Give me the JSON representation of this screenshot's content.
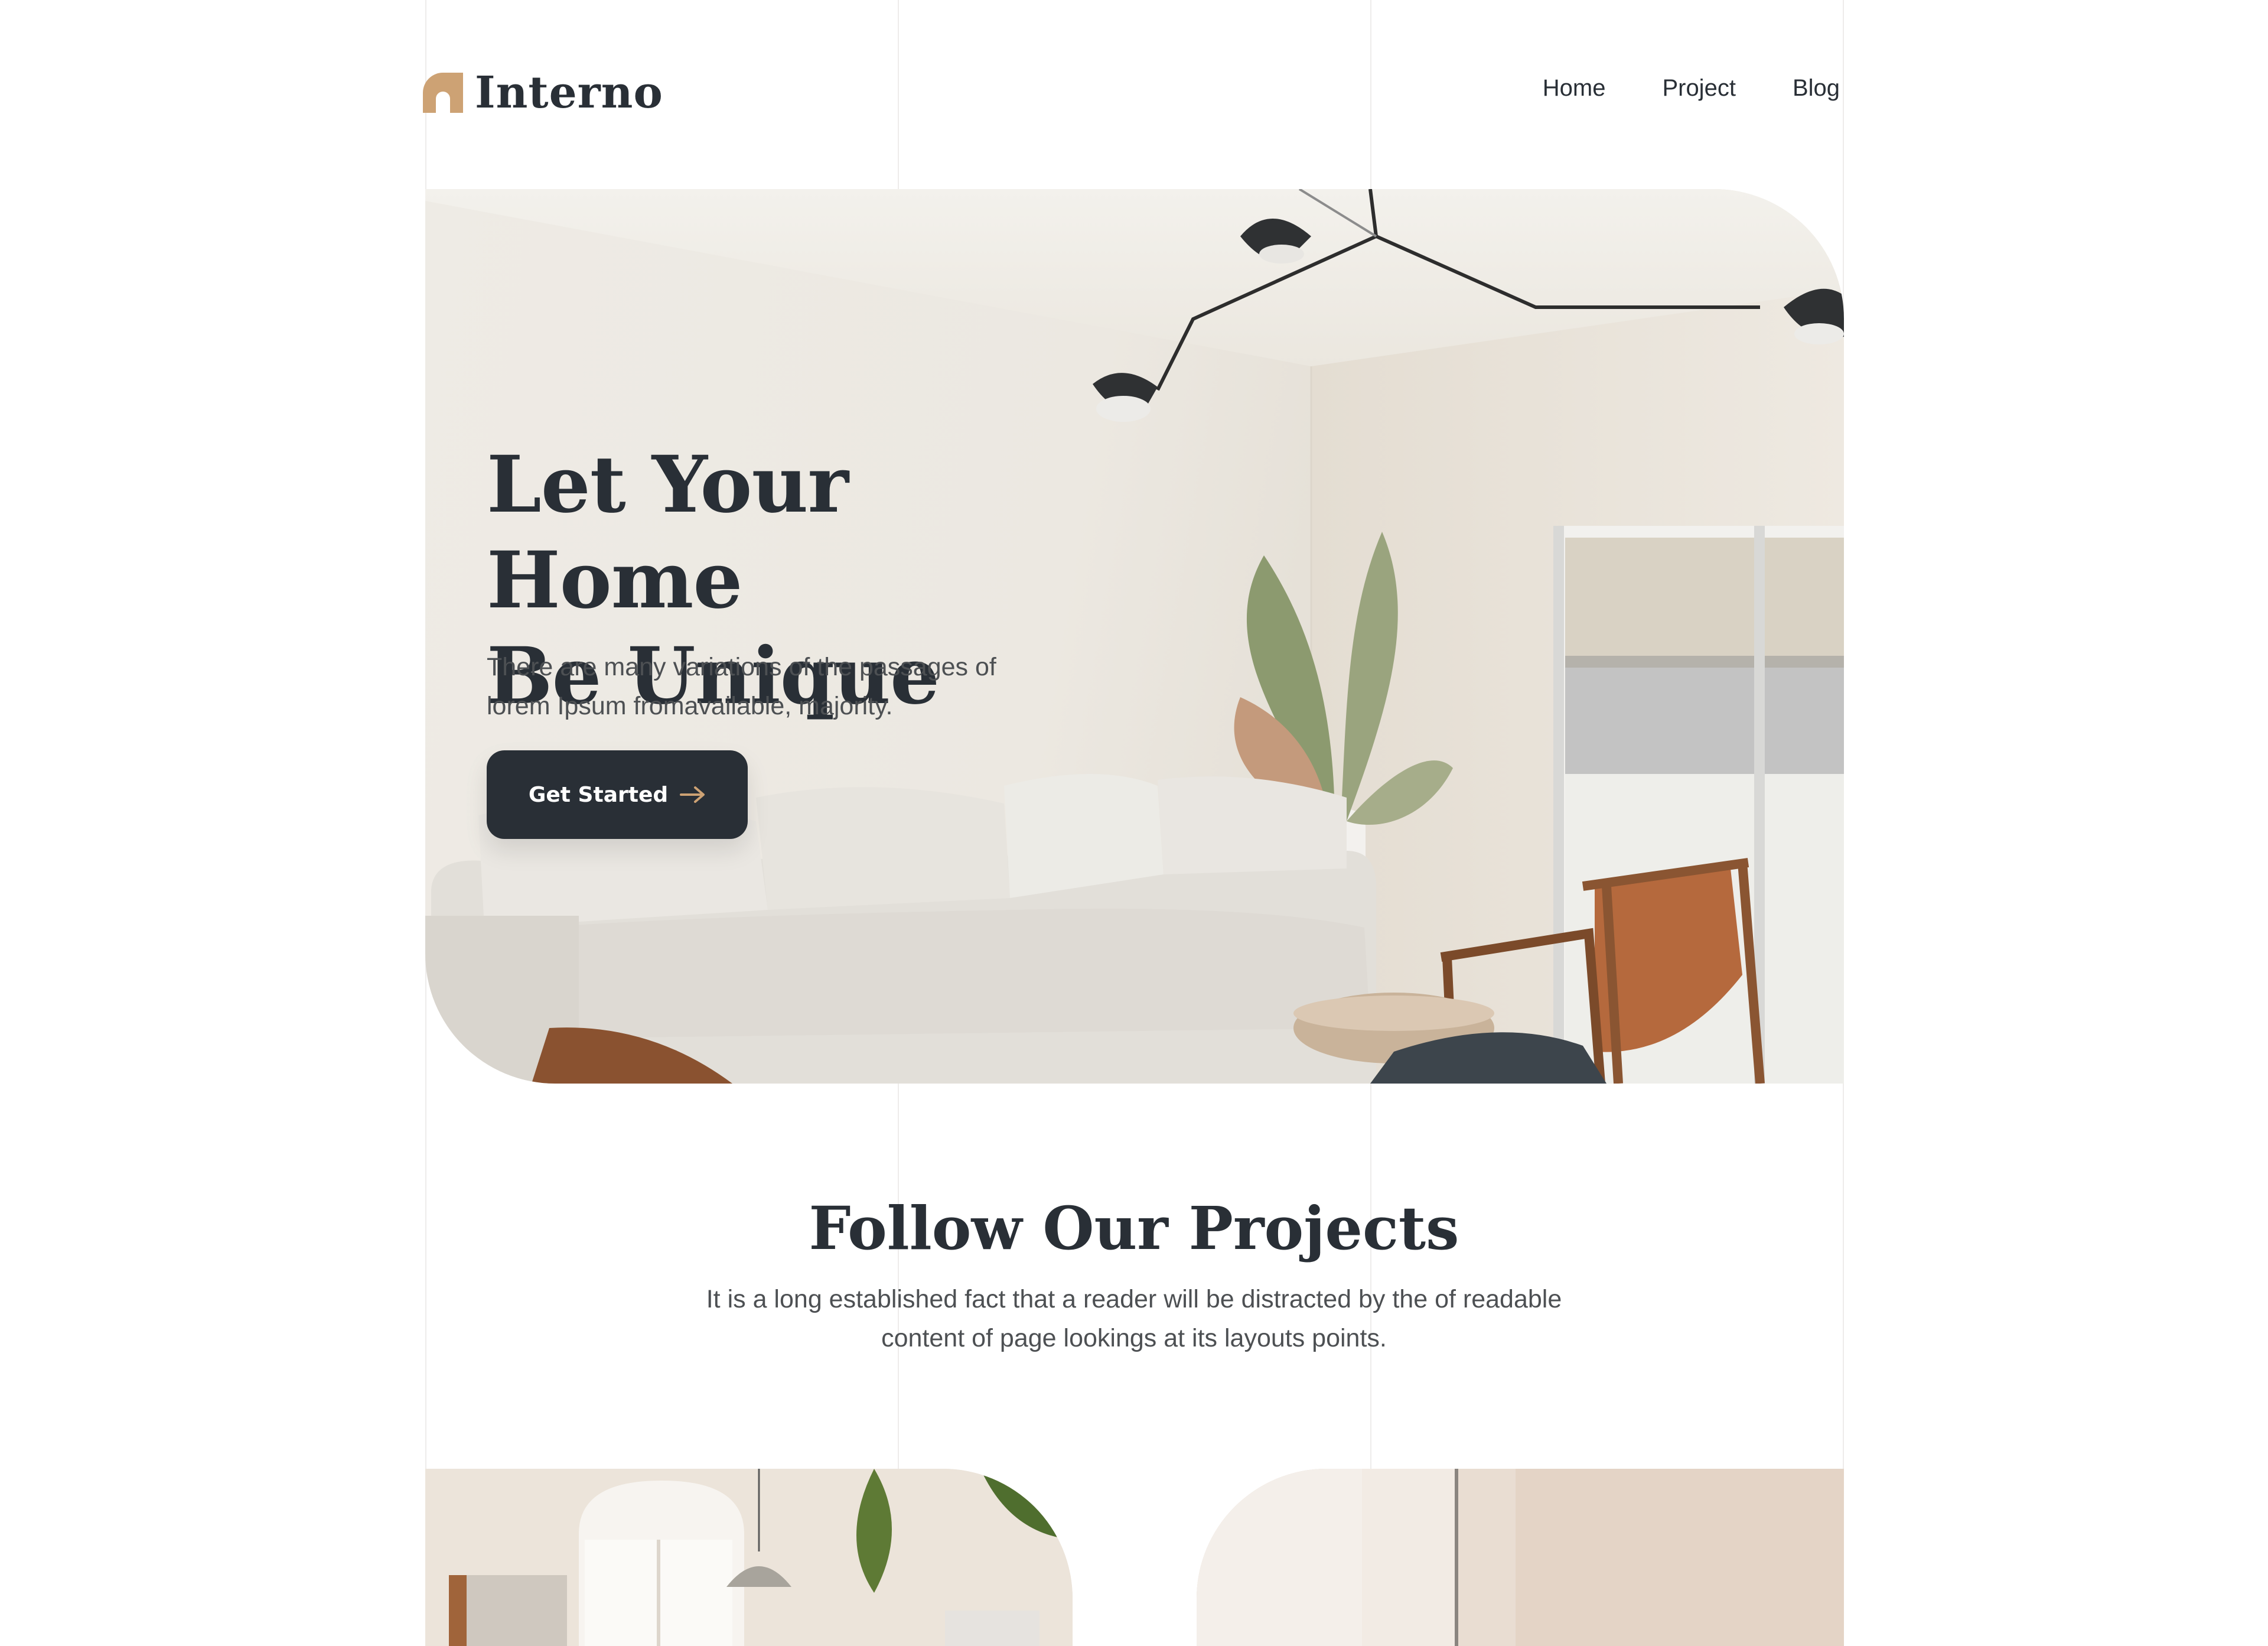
{
  "brand": {
    "name": "Interno",
    "accent": "#cda274",
    "dark": "#292f36"
  },
  "nav": {
    "items": [
      "Home",
      "Project",
      "Blog"
    ]
  },
  "hero": {
    "title_line1": "Let Your Home",
    "title_line2": "Be Unique",
    "subtitle_line1": "There are many variations of the passages of",
    "subtitle_line2": "lorem Ipsum fromavailable, majority.",
    "cta_label": "Get Started",
    "cta_icon": "arrow-right-icon"
  },
  "projects": {
    "title": "Follow Our Projects",
    "subtitle_line1": "It is a long established fact that a reader will be distracted by the of readable",
    "subtitle_line2": "content of page  lookings at its layouts  points."
  }
}
